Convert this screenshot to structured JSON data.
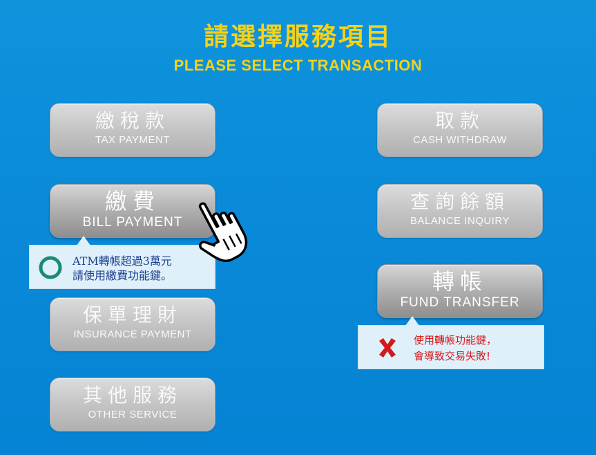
{
  "header": {
    "title_cn": "請選擇服務項目",
    "title_en": "PLEASE SELECT TRANSACTION"
  },
  "buttons": {
    "tax": {
      "cn": "繳稅款",
      "en": "TAX PAYMENT"
    },
    "bill": {
      "cn": "繳費",
      "en": "BILL PAYMENT"
    },
    "insurance": {
      "cn": "保單理財",
      "en": "INSURANCE PAYMENT"
    },
    "other": {
      "cn": "其他服務",
      "en": "OTHER SERVICE"
    },
    "cash": {
      "cn": "取款",
      "en": "CASH WITHDRAW"
    },
    "balance": {
      "cn": "查詢餘額",
      "en": "BALANCE INQUIRY"
    },
    "transfer": {
      "cn": "轉帳",
      "en": "FUND TRANSFER"
    }
  },
  "tips": {
    "ok": {
      "line1": "ATM轉帳超過3萬元",
      "line2": "請使用繳費功能鍵。",
      "icon": "circle-icon"
    },
    "bad": {
      "line1": "使用轉帳功能鍵，",
      "line2": "會導致交易失敗!",
      "icon": "cross-icon"
    }
  },
  "colors": {
    "background": "#0a8ad8",
    "title": "#f5d21a",
    "ok_icon": "#1a8a78",
    "bad_icon": "#d21a1a",
    "tip_bg": "#dff0fb"
  },
  "cursor": {
    "icon": "hand-pointer-icon"
  }
}
